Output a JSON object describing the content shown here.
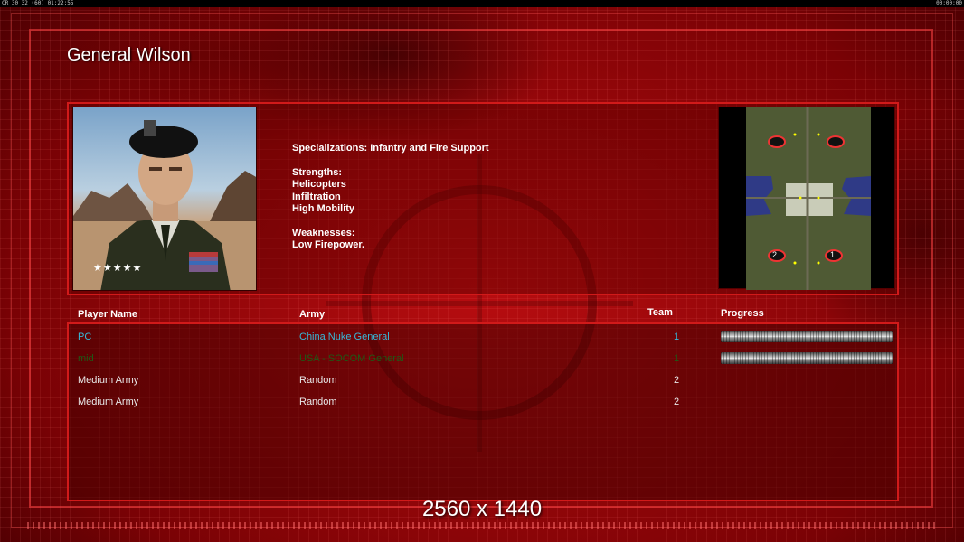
{
  "topbar": {
    "left_text": "CR 30 32 (60) 01:22:55",
    "right_text": "00:00:00"
  },
  "general": {
    "title": "General Wilson",
    "specializations": "Specializations: Infantry and Fire Support",
    "strengths_label": "Strengths:",
    "strengths": [
      "Helicopters",
      "Infiltration",
      "High Mobility"
    ],
    "weaknesses_label": "Weaknesses:",
    "weaknesses": [
      "Low Firepower."
    ],
    "rank_stars": "★★★★★"
  },
  "minimap": {
    "slots": [
      "2",
      "1"
    ]
  },
  "table": {
    "headers": {
      "player": "Player Name",
      "army": "Army",
      "team": "Team",
      "progress": "Progress"
    },
    "rows": [
      {
        "player": "PC",
        "army": "China Nuke General",
        "team": "1",
        "color": "#37b8d8",
        "progress": 0
      },
      {
        "player": "mid",
        "army": "USA - SOCOM General",
        "team": "1",
        "color": "#1e5a16",
        "progress": 0
      },
      {
        "player": "Medium Army",
        "army": "Random",
        "team": "2",
        "color": "#e8e8e8"
      },
      {
        "player": "Medium Army",
        "army": "Random",
        "team": "2",
        "color": "#e8e8e8"
      }
    ]
  },
  "resolution_label": "2560 x 1440",
  "colors": {
    "accent": "#d11a1a",
    "background": "#8a0407"
  }
}
